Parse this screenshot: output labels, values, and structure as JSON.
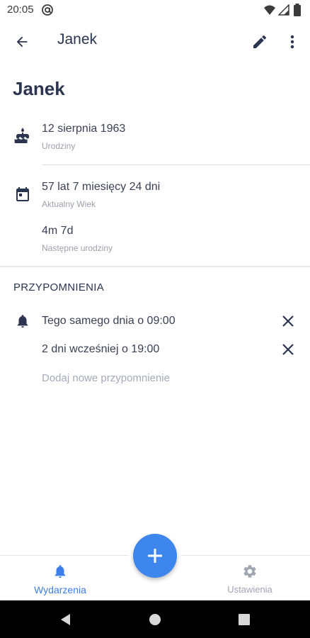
{
  "status_bar": {
    "time": "20:05",
    "left_icon": "at-sign-icon",
    "right_icons": [
      "wifi-icon",
      "signal-icon",
      "battery-icon"
    ]
  },
  "app_bar": {
    "back_icon": "arrow-back-icon",
    "title": "Janek",
    "edit_icon": "pencil-icon",
    "more_icon": "more-vertical-icon"
  },
  "contact": {
    "name": "Janek",
    "birthday": {
      "icon": "cake-icon",
      "value": "12 sierpnia 1963",
      "label": "Urodziny"
    },
    "age": {
      "icon": "calendar-icon",
      "value": "57 lat 7 miesięcy 24 dni",
      "label": "Aktualny Wiek"
    },
    "next_birthday": {
      "value": "4m 7d",
      "label": "Następne urodziny"
    }
  },
  "reminders": {
    "section_title": "PRZYPOMNIENIA",
    "icon": "bell-icon",
    "items": [
      {
        "text": "Tego samego dnia o 09:00",
        "remove_icon": "close-icon"
      },
      {
        "text": "2 dni wcześniej o 19:00",
        "remove_icon": "close-icon"
      }
    ],
    "add_label": "Dodaj nowe przypomnienie"
  },
  "fab": {
    "icon": "plus-icon"
  },
  "bottom_nav": {
    "items": [
      {
        "label": "Wydarzenia",
        "icon": "bell-icon",
        "active": true
      },
      {
        "label": "Ustawienia",
        "icon": "gear-icon",
        "active": false
      }
    ]
  },
  "system_nav": {
    "buttons": [
      "back-triangle-icon",
      "home-circle-icon",
      "recents-square-icon"
    ]
  },
  "colors": {
    "primary_text": "#2b3550",
    "accent": "#3d86ec",
    "secondary_text": "#9aa0ab",
    "divider": "#dcdfe4"
  }
}
